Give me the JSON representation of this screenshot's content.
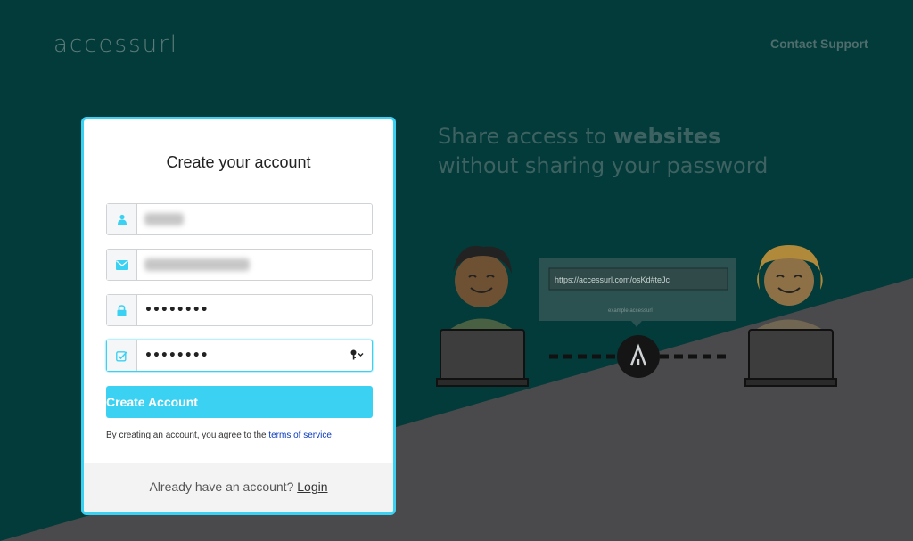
{
  "brand": {
    "logo_text": "accessurl"
  },
  "nav": {
    "contact_label": "Contact Support"
  },
  "hero": {
    "line1_prefix": "Share access to ",
    "line1_bold": "websites",
    "line2": "without sharing your password",
    "url_example": "https://accessurl.com/osKd#teJc",
    "url_caption": "example accessurl"
  },
  "form": {
    "title": "Create your account",
    "password_mask": "••••••••",
    "confirm_mask": "••••••••",
    "submit_label": "Create Account",
    "terms_prefix": "By creating an account, you agree to the ",
    "terms_link": "terms of service",
    "footer_prefix": "Already have an account? ",
    "footer_link": "Login"
  },
  "colors": {
    "accent": "#3ad1f3",
    "teal_bg": "#023b3a",
    "gray_bg": "#4a4a4c"
  }
}
